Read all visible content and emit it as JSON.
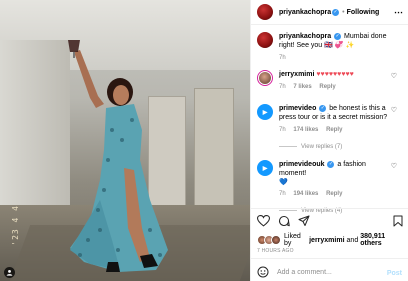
{
  "header": {
    "username": "priyankachopra",
    "separator": "•",
    "follow_label": "Following",
    "more_label": "⋯"
  },
  "caption": {
    "username": "priyankachopra",
    "text": "Mumbai done right! See you",
    "emojis": "🇬🇧 💞 ✨",
    "time": "7h"
  },
  "comments": [
    {
      "username": "jerryxmimi",
      "text": "♥♥♥♥♥♥♥♥♥",
      "time": "7h",
      "likes": "7 likes",
      "reply_label": "Reply"
    },
    {
      "username": "primevideo",
      "text": "be honest is this a press tour or is it a secret mission?",
      "time": "7h",
      "likes": "174 likes",
      "reply_label": "Reply",
      "view_replies": "View replies (7)"
    },
    {
      "username": "primevideouk",
      "text": "a fashion moment!",
      "emoji": "💙",
      "time": "7h",
      "likes": "194 likes",
      "reply_label": "Reply",
      "view_replies": "View replies (4)"
    }
  ],
  "likes": {
    "prefix": "Liked by",
    "user": "jerryxmimi",
    "conjunction": "and",
    "count": "380,911 others"
  },
  "posted": "7 HOURS AGO",
  "composer": {
    "placeholder": "Add a comment...",
    "post_label": "Post"
  },
  "photo": {
    "datestamp": "'23 4 4"
  },
  "colors": {
    "accent": "#0095f6",
    "heart": "#ed4956",
    "verified": "#3897f0"
  }
}
